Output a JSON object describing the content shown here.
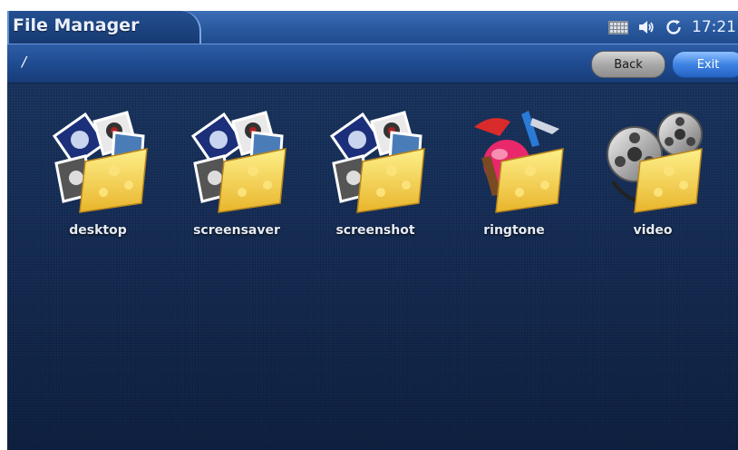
{
  "title_bar": {
    "app_title": "File Manager",
    "status_icons": [
      "keyboard-icon",
      "volume-icon",
      "sync-icon"
    ],
    "clock": "17:21"
  },
  "path_bar": {
    "path": "/",
    "back_label": "Back",
    "exit_label": "Exit"
  },
  "folders": [
    {
      "label": "desktop",
      "icon": "photos-folder-icon"
    },
    {
      "label": "screensaver",
      "icon": "photos-folder-icon"
    },
    {
      "label": "screenshot",
      "icon": "photos-folder-icon"
    },
    {
      "label": "ringtone",
      "icon": "music-folder-icon"
    },
    {
      "label": "video",
      "icon": "film-reel-folder-icon"
    }
  ],
  "colors": {
    "background": "#18305a",
    "title_bar": "#2a5aa0",
    "back_button": "#a9a9a9",
    "exit_button": "#3d84e3",
    "folder": "#f4d24a"
  }
}
